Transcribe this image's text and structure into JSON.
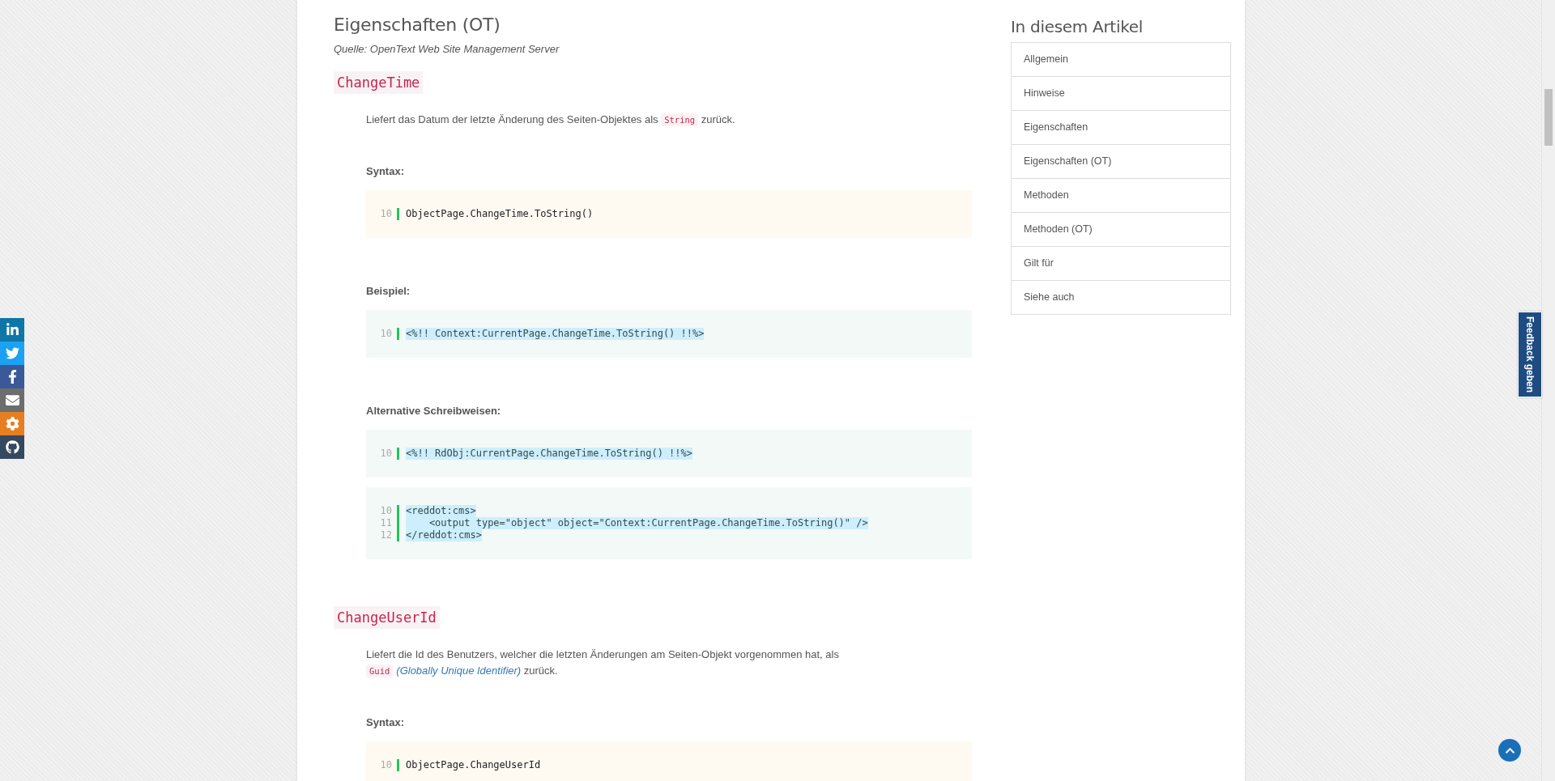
{
  "social_bar": [
    {
      "kind": "linkedin",
      "color": "#0e76a8"
    },
    {
      "kind": "twitter",
      "color": "#1da1f2"
    },
    {
      "kind": "facebook",
      "color": "#3b5998"
    },
    {
      "kind": "mail",
      "color": "#6d6d6d"
    },
    {
      "kind": "gear",
      "color": "#e67e22"
    },
    {
      "kind": "github",
      "color": "#34495e"
    }
  ],
  "article": {
    "heading": "Eigenschaften (OT)",
    "source": "Quelle: OpenText Web Site Management Server",
    "properties": [
      {
        "name": "ChangeTime",
        "description": [
          {
            "kind": "text",
            "text": "Liefert das Datum der letzte Änderung des Seiten-Objektes als "
          },
          {
            "kind": "code",
            "text": "String"
          },
          {
            "kind": "text",
            "text": " zurück."
          }
        ],
        "sections": [
          {
            "label": "Syntax:",
            "blocks": [
              {
                "kind": "syntax",
                "highlighted": false,
                "lines": [
                  {
                    "number": "10",
                    "text": "ObjectPage.ChangeTime.ToString()"
                  }
                ]
              }
            ]
          },
          {
            "label": "Beispiel:",
            "blocks": [
              {
                "kind": "example",
                "highlighted": true,
                "lines": [
                  {
                    "number": "10",
                    "text": "<%!! Context:CurrentPage.ChangeTime.ToString() !!%>"
                  }
                ]
              }
            ]
          },
          {
            "label": "Alternative Schreibweisen:",
            "blocks": [
              {
                "kind": "example",
                "highlighted": true,
                "lines": [
                  {
                    "number": "10",
                    "text": "<%!! RdObj:CurrentPage.ChangeTime.ToString() !!%>"
                  }
                ]
              },
              {
                "kind": "example",
                "highlighted": true,
                "lines": [
                  {
                    "number": "10",
                    "text": "<reddot:cms>"
                  },
                  {
                    "number": "11",
                    "text": "    <output type=\"object\" object=\"Context:CurrentPage.ChangeTime.ToString()\" />"
                  },
                  {
                    "number": "12",
                    "text": "</reddot:cms>"
                  }
                ]
              }
            ]
          }
        ]
      },
      {
        "name": "ChangeUserId",
        "description": [
          {
            "kind": "text",
            "text": "Liefert die Id des Benutzers, welcher die letzten Änderungen am Seiten-Objekt vorgenommen hat, als "
          },
          {
            "kind": "code",
            "text": "Guid"
          },
          {
            "kind": "link",
            "text": "(Globally Unique Identifier)"
          },
          {
            "kind": "text",
            "text": " zurück."
          }
        ],
        "sections": [
          {
            "label": "Syntax:",
            "blocks": [
              {
                "kind": "syntax",
                "highlighted": false,
                "lines": [
                  {
                    "number": "10",
                    "text": "ObjectPage.ChangeUserId"
                  }
                ]
              }
            ]
          }
        ]
      }
    ]
  },
  "toc": {
    "title": "In diesem Artikel",
    "items": [
      "Allgemein",
      "Hinweise",
      "Eigenschaften",
      "Eigenschaften (OT)",
      "Methoden",
      "Methoden (OT)",
      "Gilt für",
      "Siehe auch"
    ]
  },
  "feedback": {
    "label": "Feedback geben"
  }
}
